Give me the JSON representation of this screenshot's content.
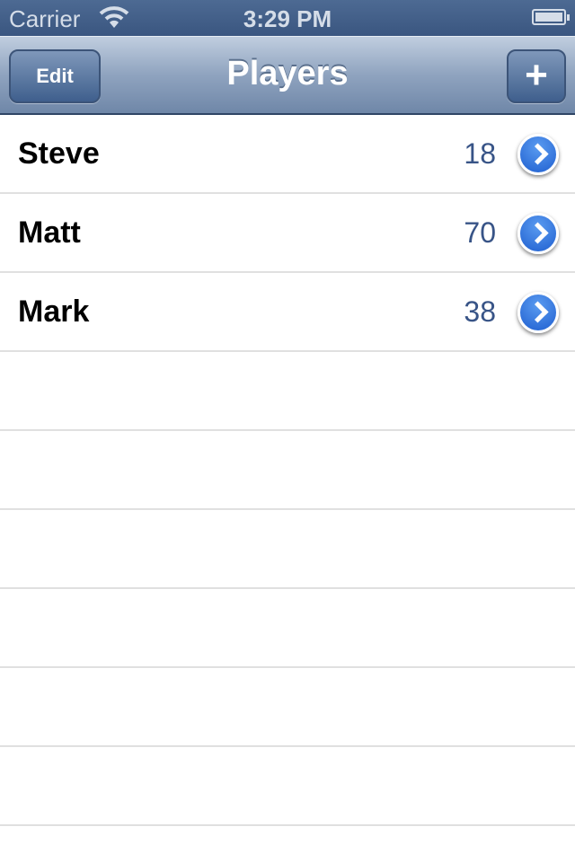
{
  "status_bar": {
    "carrier": "Carrier",
    "time": "3:29 PM"
  },
  "nav": {
    "title": "Players",
    "edit_label": "Edit",
    "add_label": "+"
  },
  "players": [
    {
      "name": "Steve",
      "value": "18"
    },
    {
      "name": "Matt",
      "value": "70"
    },
    {
      "name": "Mark",
      "value": "38"
    }
  ]
}
